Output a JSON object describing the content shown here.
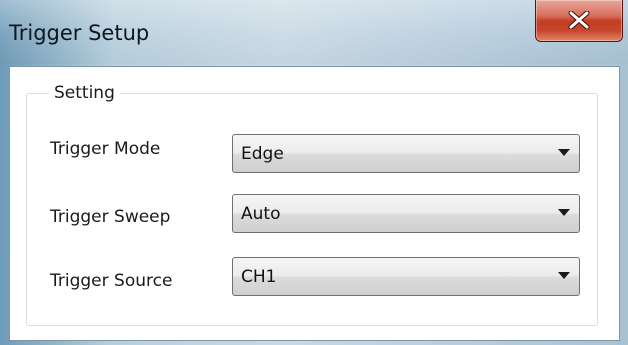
{
  "window": {
    "title": "Trigger Setup",
    "close_icon": "close-x-icon"
  },
  "group": {
    "label": "Setting"
  },
  "rows": [
    {
      "label": "Trigger Mode",
      "value": "Edge"
    },
    {
      "label": "Trigger Sweep",
      "value": "Auto"
    },
    {
      "label": "Trigger Source",
      "value": "CH1"
    }
  ],
  "colors": {
    "close_button": "#c8472c",
    "title_bar": "#c9d9e4"
  }
}
